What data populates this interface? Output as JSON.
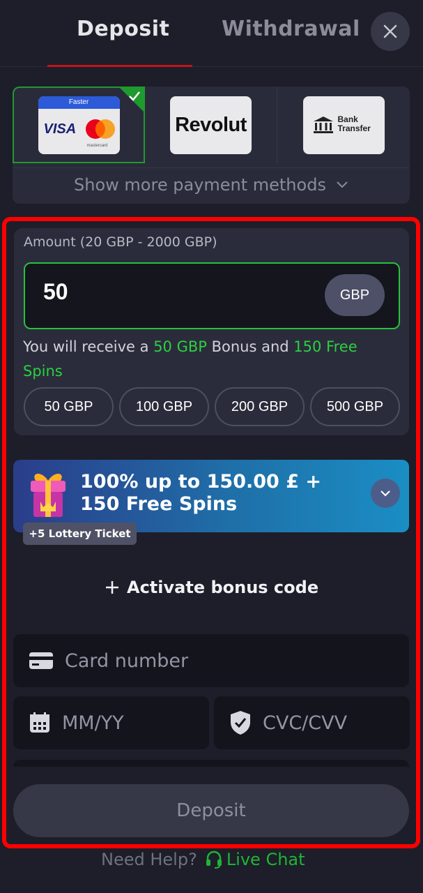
{
  "tabs": {
    "deposit": "Deposit",
    "withdrawal": "Withdrawal"
  },
  "payment_methods": {
    "visa_card": {
      "band_label": "Faster",
      "visa": "VISA",
      "mastercard": "mastercard"
    },
    "revolut": "Revolut",
    "bank": {
      "line1": "Bank",
      "line2": "Transfer"
    },
    "show_more": "Show more payment methods"
  },
  "amount": {
    "label": "Amount (20 GBP - 2000 GBP)",
    "value": "50",
    "currency": "GBP",
    "receive_prefix": "You will receive a ",
    "receive_bonus": "50 GBP",
    "receive_middle": " Bonus and ",
    "receive_spins": "150 Free Spins",
    "quick": [
      "50 GBP",
      "100 GBP",
      "200 GBP",
      "500 GBP"
    ]
  },
  "bonus": {
    "title": "100% up to 150.00 £ + 150 Free Spins",
    "badge": "+5 Lottery Ticket"
  },
  "activate_label": "Activate bonus code",
  "card": {
    "number_placeholder": "Card number",
    "expiry_placeholder": "MM/YY",
    "cvc_placeholder": "CVC/CVV"
  },
  "deposit_button": "Deposit",
  "help": {
    "text": "Need Help?",
    "live_chat": "Live Chat"
  },
  "colors": {
    "accent_green": "#2ad13f",
    "tab_underline": "#c2121b",
    "highlight": "#ff0000"
  }
}
